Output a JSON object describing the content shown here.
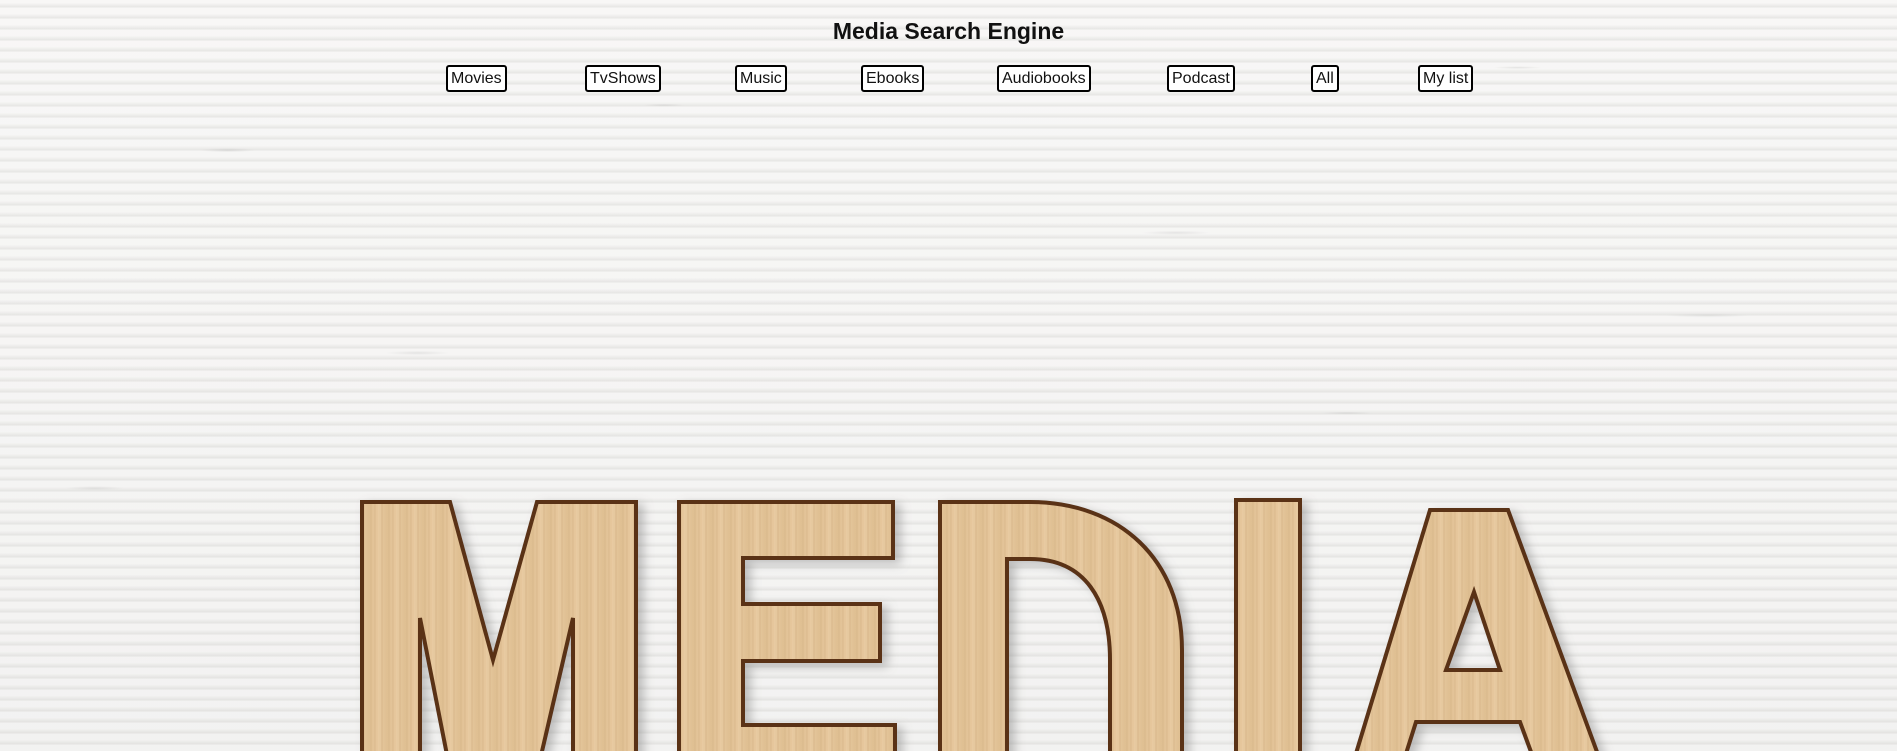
{
  "page": {
    "title": "Media Search Engine"
  },
  "nav": {
    "items": [
      {
        "label": "Movies",
        "name": "nav-button-movies"
      },
      {
        "label": "TvShows",
        "name": "nav-button-tvshows"
      },
      {
        "label": "Music",
        "name": "nav-button-music"
      },
      {
        "label": "Ebooks",
        "name": "nav-button-ebooks"
      },
      {
        "label": "Audiobooks",
        "name": "nav-button-audiobooks"
      },
      {
        "label": "Podcast",
        "name": "nav-button-podcast"
      },
      {
        "label": "All",
        "name": "nav-button-all"
      },
      {
        "label": "My list",
        "name": "nav-button-my-list"
      }
    ]
  },
  "hero": {
    "word": "MEDIA",
    "colors": {
      "wood": "#e2c49a",
      "wood_dark": "#6b3e1e",
      "wood_grain": "#caa476"
    }
  }
}
